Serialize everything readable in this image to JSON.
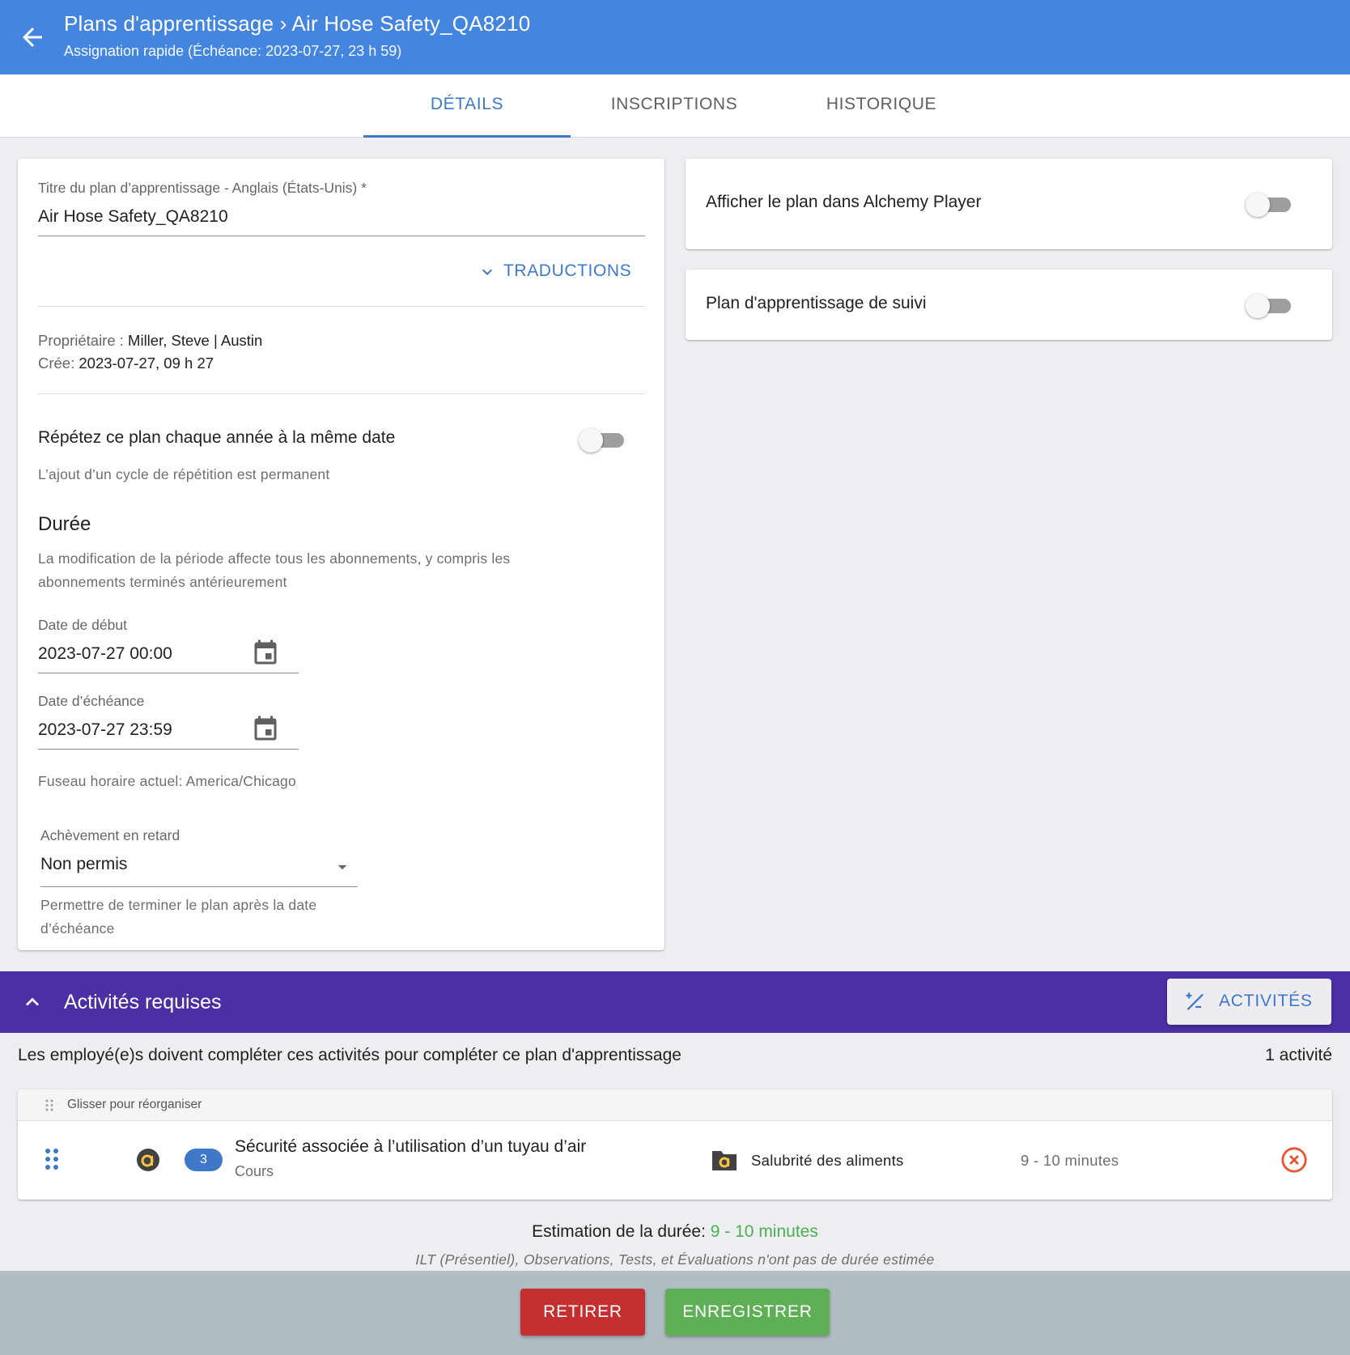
{
  "header": {
    "title": "Plans d'apprentissage › Air Hose Safety_QA8210",
    "subtitle": "Assignation rapide (Échéance: 2023-07-27, 23 h 59)"
  },
  "tabs": [
    {
      "label": "DÉTAILS",
      "active": true
    },
    {
      "label": "INSCRIPTIONS",
      "active": false
    },
    {
      "label": "HISTORIQUE",
      "active": false
    }
  ],
  "details": {
    "title_label": "Titre du plan d’apprentissage - Anglais (États-Unis) *",
    "title_value": "Air Hose Safety_QA8210",
    "translations_label": "TRADUCTIONS",
    "owner_label": "Propriétaire :",
    "owner_value": "Miller, Steve | Austin",
    "created_label": "Crée:",
    "created_value": "2023-07-27, 09 h 27",
    "repeat_label": "Répétez ce plan chaque année à la même date",
    "repeat_on": false,
    "repeat_hint": "L’ajout d’un cycle de répétition est permanent",
    "duration_heading": "Durée",
    "duration_hint_1": "La modification de la période affecte tous les abonnements, y compris les",
    "duration_hint_2": "abonnements terminés antérieurement",
    "start_label": "Date de début",
    "start_value": "2023-07-27 00:00",
    "due_label": "Date d’échéance",
    "due_value": "2023-07-27 23:59",
    "timezone": "Fuseau horaire actuel: America/Chicago",
    "late_label": "Achèvement en retard",
    "late_value": "Non permis",
    "late_hint_1": "Permettre de terminer le plan après la date",
    "late_hint_2": "d’échéance"
  },
  "side": {
    "player_label": "Afficher le plan dans Alchemy Player",
    "player_on": false,
    "followup_label": "Plan d'apprentissage de suivi",
    "followup_on": false
  },
  "activities": {
    "heading": "Activités requises",
    "button_label": "ACTIVITÉS",
    "description": "Les employé(e)s doivent compléter ces activités pour compléter ce plan d'apprentissage",
    "count": "1 activité",
    "drag_hint": "Glisser pour réorganiser",
    "items": [
      {
        "badge": "3",
        "title": "Sécurité associée à l’utilisation d’un tuyau d’air",
        "type": "Cours",
        "category": "Salubrité des aliments",
        "duration": "9 - 10 minutes"
      }
    ],
    "estimate_label": "Estimation de la durée:",
    "estimate_value": "9 - 10 minutes",
    "estimate_note": "ILT (Présentiel), Observations, Tests, et Évaluations n'ont pas de durée estimée"
  },
  "footer": {
    "remove_label": "RETIRER",
    "save_label": "ENREGISTRER"
  },
  "colors": {
    "header": "#4486df",
    "accent": "#3f78c9",
    "purple": "#4b2fa5",
    "remove": "#c62f2f",
    "save": "#5faf56",
    "estimate": "#4caf50"
  },
  "icons": [
    "arrow-left-icon",
    "chevron-down-icon",
    "calendar-icon",
    "dropdown-arrow-icon",
    "chevron-up-icon",
    "add-activity-icon",
    "drag-handle-icon",
    "alchemy-logo-icon",
    "folder-icon",
    "remove-circle-icon"
  ]
}
